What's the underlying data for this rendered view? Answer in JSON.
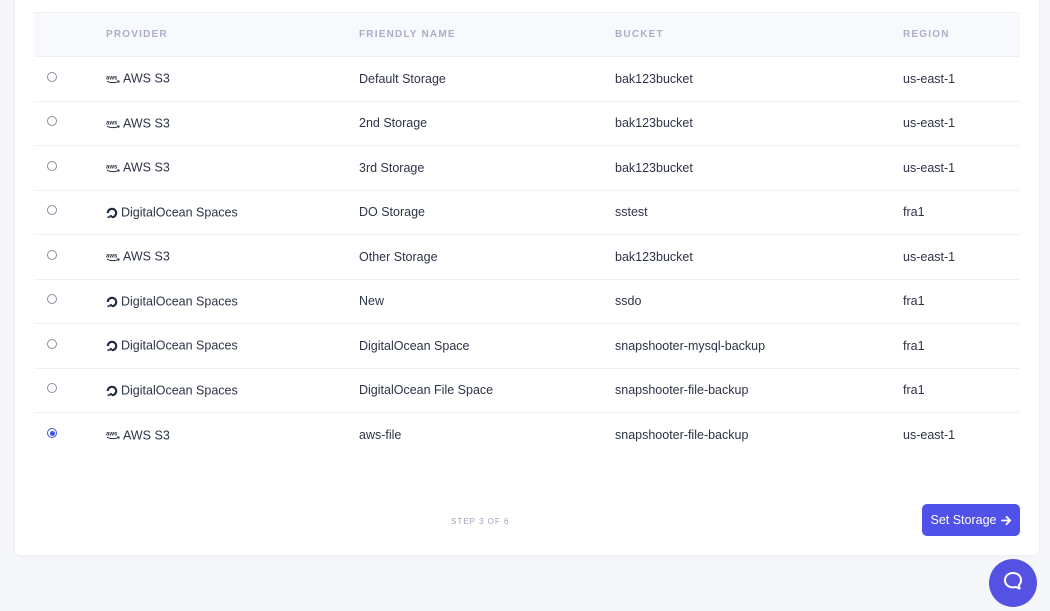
{
  "table": {
    "headers": {
      "provider": "PROVIDER",
      "friendly_name": "FRIENDLY NAME",
      "bucket": "BUCKET",
      "region": "REGION"
    },
    "rows": [
      {
        "provider": "AWS S3",
        "provider_icon": "aws-icon",
        "friendly_name": "Default Storage",
        "bucket": "bak123bucket",
        "region": "us-east-1",
        "selected": false
      },
      {
        "provider": "AWS S3",
        "provider_icon": "aws-icon",
        "friendly_name": "2nd Storage",
        "bucket": "bak123bucket",
        "region": "us-east-1",
        "selected": false
      },
      {
        "provider": "AWS S3",
        "provider_icon": "aws-icon",
        "friendly_name": "3rd Storage",
        "bucket": "bak123bucket",
        "region": "us-east-1",
        "selected": false
      },
      {
        "provider": "DigitalOcean Spaces",
        "provider_icon": "digitalocean-icon",
        "friendly_name": "DO Storage",
        "bucket": "sstest",
        "region": "fra1",
        "selected": false
      },
      {
        "provider": "AWS S3",
        "provider_icon": "aws-icon",
        "friendly_name": "Other Storage",
        "bucket": "bak123bucket",
        "region": "us-east-1",
        "selected": false
      },
      {
        "provider": "DigitalOcean Spaces",
        "provider_icon": "digitalocean-icon",
        "friendly_name": "New",
        "bucket": "ssdo",
        "region": "fra1",
        "selected": false
      },
      {
        "provider": "DigitalOcean Spaces",
        "provider_icon": "digitalocean-icon",
        "friendly_name": "DigitalOcean Space",
        "bucket": "snapshooter-mysql-backup",
        "region": "fra1",
        "selected": false
      },
      {
        "provider": "DigitalOcean Spaces",
        "provider_icon": "digitalocean-icon",
        "friendly_name": "DigitalOcean File Space",
        "bucket": "snapshooter-file-backup",
        "region": "fra1",
        "selected": false
      },
      {
        "provider": "AWS S3",
        "provider_icon": "aws-icon",
        "friendly_name": "aws-file",
        "bucket": "snapshooter-file-backup",
        "region": "us-east-1",
        "selected": true
      }
    ]
  },
  "footer": {
    "step_text": "STEP 3 OF 6",
    "button_label": "Set Storage",
    "button_icon": "arrow-right-icon"
  },
  "chat": {
    "icon": "chat-bubble-icon"
  },
  "colors": {
    "accent": "#4f51e8",
    "radio_selected": "#3c54e6",
    "header_text": "#a7b0c7",
    "body_text": "#2d3446",
    "background": "#f6f7fb"
  }
}
